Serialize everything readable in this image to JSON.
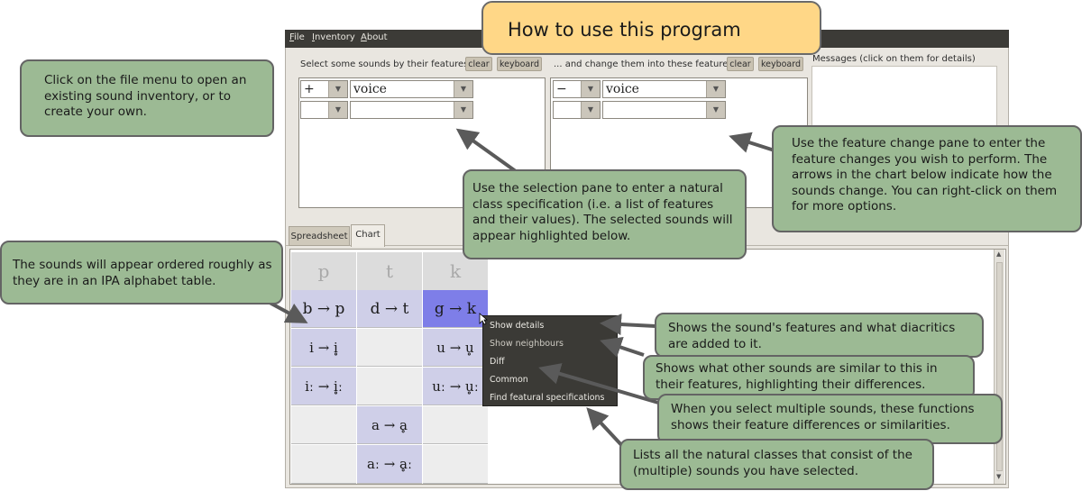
{
  "title_callout": "How to use this program",
  "menu": {
    "file": "File",
    "inventory": "Inventory",
    "about": "About"
  },
  "selection": {
    "label": "Select some sounds by their features:",
    "clear": "clear",
    "keyboard": "keyboard",
    "rows": [
      {
        "value": "+",
        "feature": "voice"
      },
      {
        "value": "",
        "feature": ""
      }
    ]
  },
  "change": {
    "label": "... and change them into these features:",
    "clear": "clear",
    "keyboard": "keyboard",
    "rows": [
      {
        "value": "−",
        "feature": "voice"
      },
      {
        "value": "",
        "feature": ""
      }
    ]
  },
  "messages_label": "Messages (click on them for details)",
  "tabs": {
    "spreadsheet": "Spreadsheet",
    "chart": "Chart",
    "active": "chart"
  },
  "chart": {
    "headers": [
      "p",
      "t",
      "k"
    ],
    "rows": [
      [
        "b → p",
        "d → t",
        "g → k"
      ],
      [
        "i → i̥",
        "",
        "u → u̥"
      ],
      [
        "iː → i̥ː",
        "",
        "uː → u̥ː"
      ],
      [
        "",
        "a → ḁ",
        ""
      ],
      [
        "",
        "aː → ḁː",
        ""
      ]
    ]
  },
  "context_menu": [
    "Show details",
    "Show neighbours",
    "Diff",
    "Common",
    "Find featural specifications"
  ],
  "callouts": {
    "file_menu": "Click on the file menu to open an existing sound inventory, or to create your own.",
    "selection_pane": "Use the selection pane to enter a natural class specification (i.e. a list of features and their values). The selected sounds will appear highlighted below.",
    "change_pane": "Use the feature change pane to enter the feature changes you wish to perform. The arrows in the chart below indicate how the sounds change. You can right-click on them for more options.",
    "ordering": "The sounds will appear ordered roughly as they are in an IPA alphabet table.",
    "show_details": "Shows the sound's features and what diacritics are added to it.",
    "show_neighbours": "Shows what other sounds are similar to this in their features, highlighting their differences.",
    "diff_common": "When you select multiple sounds, these functions shows their feature differences or similarities.",
    "featural_spec": "Lists all the natural classes that consist of the (multiple) sounds you have selected."
  },
  "colors": {
    "callout_fill": "#9cba94",
    "title_fill": "#ffd787",
    "highlight": "#cfcfe8",
    "selected": "#7e7ee8"
  }
}
